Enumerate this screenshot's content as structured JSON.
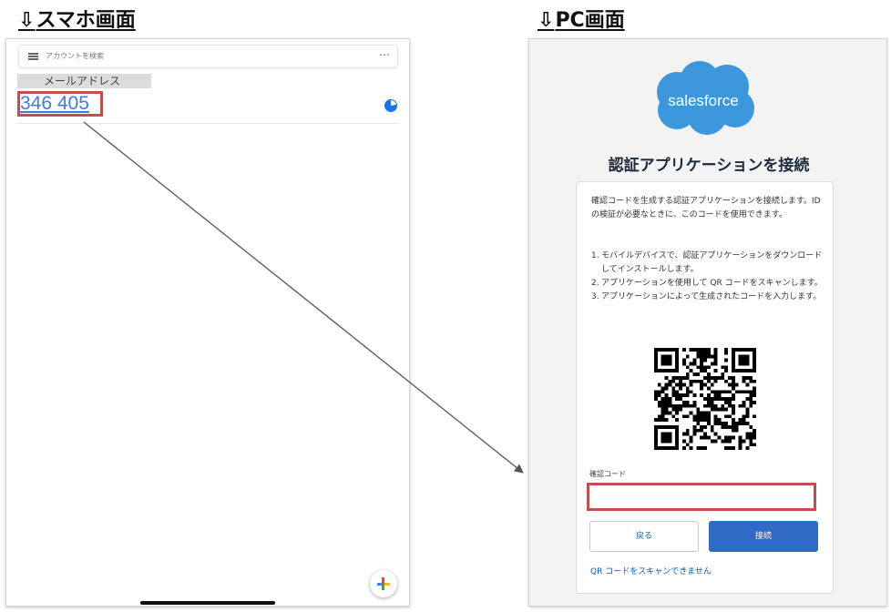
{
  "headings": {
    "phone_arrow": "⇩",
    "phone": "スマホ画面",
    "pc_arrow": "⇩",
    "pc": "PC画面"
  },
  "phone": {
    "search_placeholder": "アカウントを検索",
    "more_icon": "⋯",
    "account_name": "メールアドレス",
    "otp_code": "346 405",
    "timer_icon": "countdown-pie-icon",
    "add_icon": "plus-icon"
  },
  "pc": {
    "logo_text": "salesforce",
    "title": "認証アプリケーションを接続",
    "description": "確認コードを生成する認証アプリケーションを接続します。ID の検証が必要なときに、このコードを使用できます。",
    "steps": [
      {
        "num": "1.",
        "text": "モバイルデバイスで、認証アプリケーションをダウンロードしてインストールします。"
      },
      {
        "num": "2.",
        "text": "アプリケーションを使用して QR コードをスキャンします。"
      },
      {
        "num": "3.",
        "text": "アプリケーションによって生成されたコードを入力します。"
      }
    ],
    "code_label": "確認コード",
    "code_value": "",
    "back_button": "戻る",
    "connect_button": "接続",
    "cant_scan_link": "QR コードをスキャンできません"
  },
  "colors": {
    "highlight_border": "#c0504d",
    "otp_blue": "#3b7de0",
    "salesforce_blue": "#3c97dd",
    "connect_button": "#2f6ac7",
    "link": "#0b5cab"
  }
}
